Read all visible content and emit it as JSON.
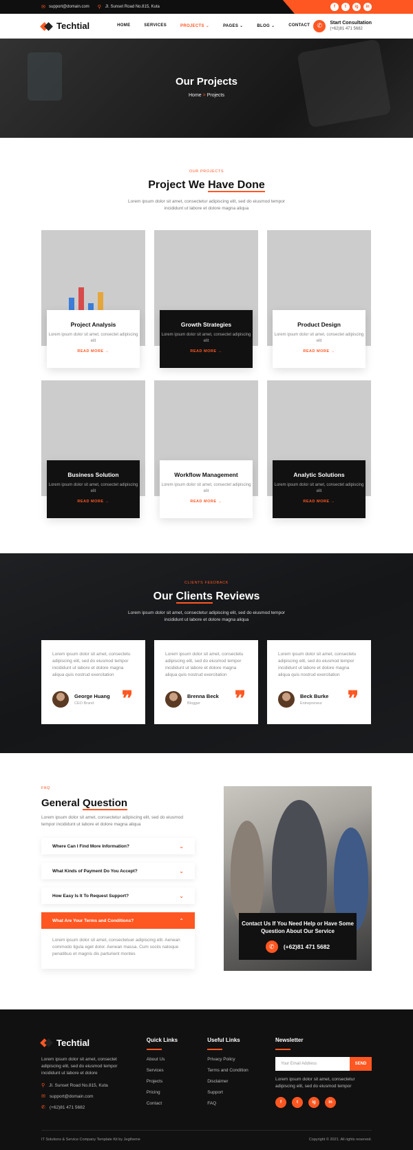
{
  "topbar": {
    "email": "support@domain.com",
    "address": "Jl. Sunset Road No.815, Kuta",
    "social": [
      "f",
      "t",
      "ig",
      "in"
    ]
  },
  "nav": {
    "brand": "Techtial",
    "menu": [
      "HOME",
      "SERVICES",
      "PROJECTS",
      "PAGES",
      "BLOG",
      "CONTACT"
    ],
    "active": "PROJECTS",
    "consult_title": "Start Consultation",
    "consult_phone": "(+62)81 471 5682"
  },
  "hero": {
    "title": "Our Projects",
    "crumb_home": "Home",
    "crumb_sep": ">",
    "crumb_current": "Projects"
  },
  "projects": {
    "tag": "OUR PROJECTS",
    "title_a": "Project We ",
    "title_b": "Have Done",
    "desc": "Lorem ipsum dolor sit amet, consectetur adipiscing elit, sed do eiusmod tempor incididunt ut labore et dolore magna aliqua",
    "read_more": "READ MORE →",
    "items": [
      {
        "title": "Project Analysis",
        "desc": "Lorem ipsum dolor sit amet, consectet adipiscing elit"
      },
      {
        "title": "Growth Strategies",
        "desc": "Lorem ipsum dolor sit amet, consectet adipiscing elit"
      },
      {
        "title": "Product Design",
        "desc": "Lorem ipsum dolor sit amet, consectet adipiscing elit"
      },
      {
        "title": "Business Solution",
        "desc": "Lorem ipsum dolor sit amet, consectet adipiscing elit"
      },
      {
        "title": "Workflow Management",
        "desc": "Lorem ipsum dolor sit amet, consectet adipiscing elit"
      },
      {
        "title": "Analytic Solutions",
        "desc": "Lorem ipsum dolor sit amet, consectet adipiscing elit"
      }
    ]
  },
  "reviews": {
    "tag": "CLIENTS FEEDBACK",
    "title_a": "Our ",
    "title_b": "Clients",
    "title_c": " Reviews",
    "desc": "Lorem ipsum dolor sit amet, consectetur adipiscing elit, sed do eiusmod tempor incididunt ut labore et dolore magna aliqua",
    "items": [
      {
        "text": "Lorem ipsum dolor sit amet, consectetu adipiscing elit, sed do eiusmod tempor incididunt ut labore et dolore magna aliqua quis nostrud exercitation",
        "name": "George Huang",
        "role": "CEO Brand"
      },
      {
        "text": "Lorem ipsum dolor sit amet, consectetu adipiscing elit, sed do eiusmod tempor incididunt ut labore et dolore magna aliqua quis nostrud exercitation",
        "name": "Brenna Beck",
        "role": "Blogger"
      },
      {
        "text": "Lorem ipsum dolor sit amet, consectetu adipiscing elit, sed do eiusmod tempor incididunt ut labore et dolore magna aliqua quis nostrud exercitation",
        "name": "Beck Burke",
        "role": "Entrepreneur"
      }
    ]
  },
  "faq": {
    "tag": "FAQ",
    "title_a": "General ",
    "title_b": "Question",
    "desc": "Lorem ipsum dolor sit amet, consectetur adipiscing elit, sed do eiusmod tempor incididunt ut labore et dolore magna aliqua",
    "questions": [
      "Where Can I Find More Information?",
      "What Kinds of Payment Do You Accept?",
      "How Easy Is It To Request Support?",
      "What Are Your Terms and Conditions?"
    ],
    "answer": "Lorem ipsum dolor sit amet, consectetuer adipiscing elit. Aenean commodo ligula eget dolor. Aenean massa. Cum sociis natoque penatibus et magnis dis parturient montes",
    "contact_text": "Contact Us If You Need Help or Have Some Question About Our Service",
    "contact_phone": "(+62)81 471 5682"
  },
  "footer": {
    "brand": "Techtial",
    "about": "Lorem ipsum dolor sit amet, consectet adipiscing elit, sed do eiusmod tempor incididunt ut labore et dolore",
    "address": "Jl. Sunset Road No.815, Kuta",
    "email": "support@domain.com",
    "phone": "(+62)81 471 5682",
    "quick_title": "Quick Links",
    "quick": [
      "About Us",
      "Services",
      "Projects",
      "Pricing",
      "Contact"
    ],
    "useful_title": "Useful Links",
    "useful": [
      "Privacy Policy",
      "Terms and Condition",
      "Disclaimer",
      "Support",
      "FAQ"
    ],
    "news_title": "Newsletter",
    "news_placeholder": "Your Email Address",
    "news_button": "SEND",
    "news_desc": "Lorem ipsum dolor sit amet, consectetur adipiscing elit, sed do eiusmod tempor",
    "bottom_left": "IT Solutions & Service Company Template Kit by Jegtheme",
    "bottom_right": "Copyright © 2021. All rights reserved."
  }
}
